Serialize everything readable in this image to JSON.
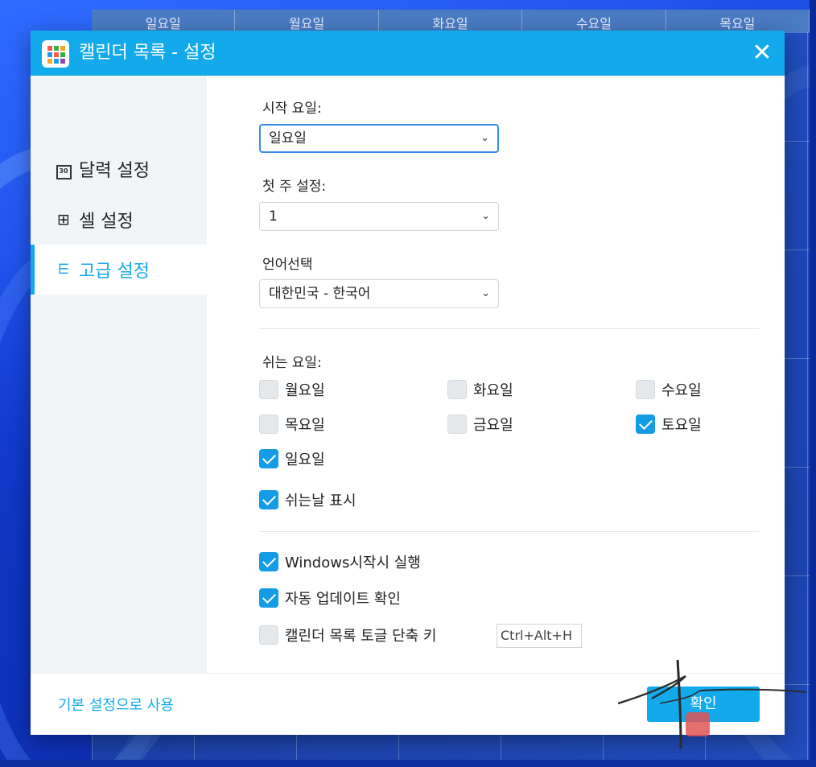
{
  "background_calendar": {
    "days": [
      "일요일",
      "월요일",
      "화요일",
      "수요일",
      "목요일"
    ]
  },
  "dialog": {
    "title": "캘린더 목록 - 설정",
    "close_icon": "close-icon",
    "app_icon_colors": [
      "#f45b4b",
      "#33b24a",
      "#f5a623",
      "#1e9be6",
      "#f45b4b",
      "#33b24a",
      "#f5a623",
      "#1e9be6",
      "#8e44ad"
    ]
  },
  "sidebar": {
    "items": [
      {
        "label": "달력 설정",
        "icon": "calendar-icon"
      },
      {
        "label": "셀 설정",
        "icon": "grid-icon"
      },
      {
        "label": "고급 설정",
        "icon": "sliders-icon"
      }
    ],
    "active_index": 2
  },
  "advanced": {
    "start_day": {
      "label": "시작 요일:",
      "value": "일요일"
    },
    "first_week": {
      "label": "첫 주 설정:",
      "value": "1"
    },
    "language": {
      "label": "언어선택",
      "value": "대한민국 - 한국어"
    },
    "rest_days": {
      "label": "쉬는 요일:",
      "days": [
        {
          "label": "월요일",
          "checked": false
        },
        {
          "label": "화요일",
          "checked": false
        },
        {
          "label": "수요일",
          "checked": false
        },
        {
          "label": "목요일",
          "checked": false
        },
        {
          "label": "금요일",
          "checked": false
        },
        {
          "label": "토요일",
          "checked": true
        },
        {
          "label": "일요일",
          "checked": true
        }
      ]
    },
    "show_holidays": {
      "label": "쉬는날 표시",
      "checked": true
    },
    "run_on_startup": {
      "label": "Windows시작시 실행",
      "checked": true
    },
    "auto_update": {
      "label": "자동 업데이트 확인",
      "checked": true
    },
    "toggle_hotkey": {
      "label": "캘린더 목록 토글 단축 키",
      "checked": false,
      "value": "Ctrl+Alt+H"
    }
  },
  "footer": {
    "reset_label": "기본 설정으로 사용",
    "ok_label": "확인"
  },
  "colors": {
    "accent": "#12aaea",
    "checkbox_checked": "#139be6"
  }
}
